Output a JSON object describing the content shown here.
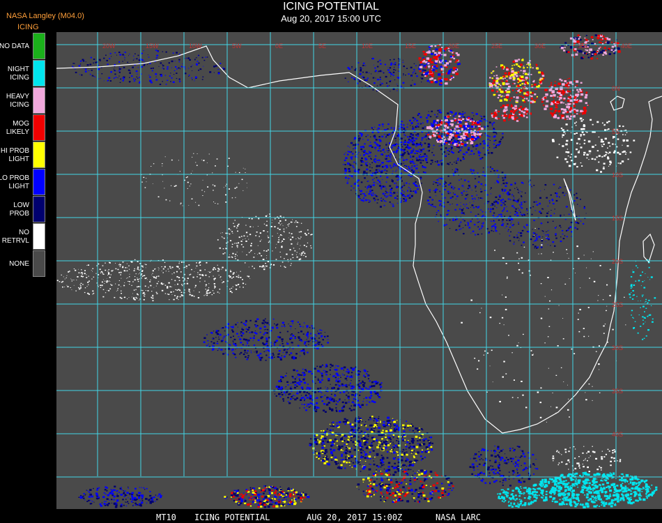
{
  "header": {
    "source": "NASA Langley (M04.0)",
    "product": "ICING",
    "title": "ICING POTENTIAL",
    "datetime": "Aug 20, 2017 15:00 UTC"
  },
  "legend": [
    {
      "label": "NO DATA",
      "color": "#1bb01b"
    },
    {
      "label": "NIGHT\nICING",
      "color": "#00e5ee"
    },
    {
      "label": "HEAVY\nICING",
      "color": "#f0a8dc"
    },
    {
      "label": "MOG\nLIKELY",
      "color": "#f00000"
    },
    {
      "label": "HI PROB\nLIGHT",
      "color": "#ffff00"
    },
    {
      "label": "LO PROB\nLIGHT",
      "color": "#0000ff"
    },
    {
      "label": "LOW\nPROB",
      "color": "#00006e"
    },
    {
      "label": "NO\nRETRVL",
      "color": "#ffffff"
    },
    {
      "label": "NONE",
      "color": "#4a4a4a"
    }
  ],
  "map": {
    "background": "#4a4a4a",
    "grid_color": "#43d6e6",
    "grid_label_color": "#c83232",
    "lon_labels": [
      "20W",
      "15W",
      "10W",
      "5W",
      "0E",
      "5E",
      "10E",
      "15E",
      "20E",
      "25E",
      "30E",
      "35E",
      "40E",
      "45E"
    ],
    "lat_labels": [
      "0N",
      "5S",
      "10S",
      "15S",
      "20S",
      "25S",
      "30S",
      "35S",
      "40S"
    ]
  },
  "footer": {
    "sat": "MT10",
    "product": "ICING POTENTIAL",
    "datetime": "AUG 20, 2017 15:00Z",
    "agency": "NASA LARC"
  }
}
